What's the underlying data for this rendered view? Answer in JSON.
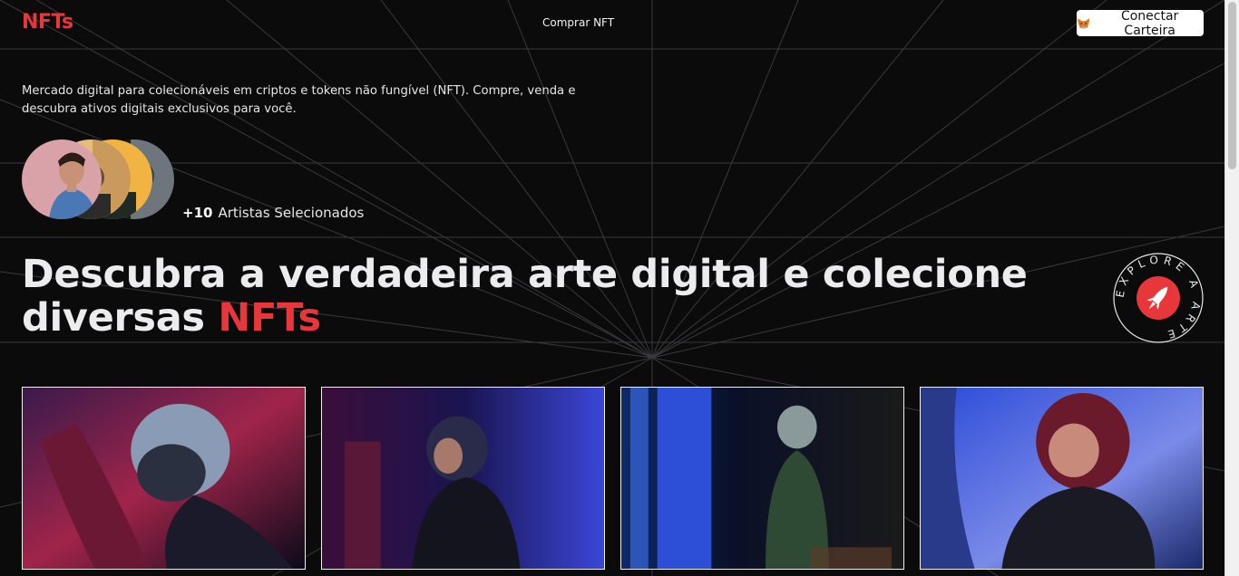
{
  "header": {
    "logo": "NFTs",
    "nav_buy": "Comprar NFT",
    "wallet_button": "Conectar Carteira"
  },
  "intro": {
    "description": "Mercado digital para colecionáveis em criptos e tokens não fungível (NFT). Compre, venda e descubra ativos digitais exclusivos para você."
  },
  "artists": {
    "count": "+10",
    "label": "Artistas Selecionados"
  },
  "hero": {
    "title_main": "Descubra a verdadeira arte digital e colecione diversas ",
    "title_accent": "NFTs"
  },
  "badge": {
    "text": "EXPLORE A ARTE"
  },
  "colors": {
    "accent": "#e8373b",
    "background": "#0b0b0c"
  },
  "gallery": {
    "items": [
      {
        "icon": "astronaut-red-image"
      },
      {
        "icon": "astronaut-purple-image"
      },
      {
        "icon": "astronaut-green-image"
      },
      {
        "icon": "astronaut-blue-image"
      }
    ]
  }
}
